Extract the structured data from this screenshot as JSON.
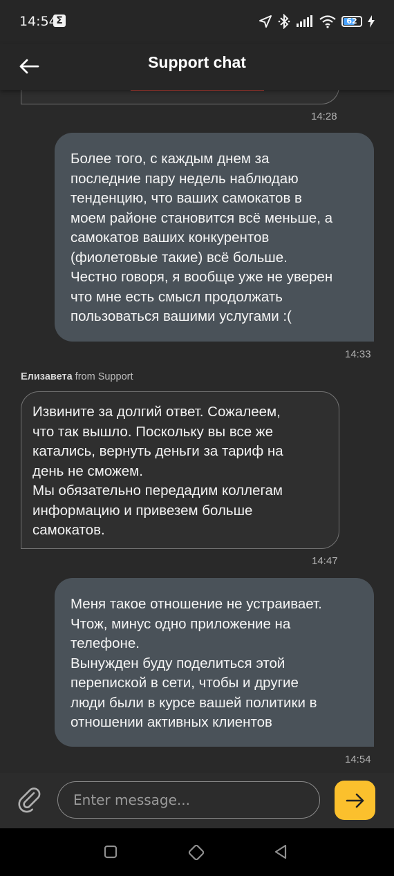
{
  "status_bar": {
    "time": "14:54",
    "notification_icon": "sigma-icon",
    "battery_level": "62",
    "icons": [
      "location-icon",
      "bluetooth-icon",
      "signal-icon",
      "wifi-icon",
      "battery-icon",
      "charging-icon"
    ]
  },
  "header": {
    "title": "Support chat",
    "back_icon": "arrow-left-icon"
  },
  "messages": [
    {
      "direction": "incoming",
      "partial": true,
      "time": "14:28"
    },
    {
      "direction": "outgoing",
      "text": "Более того, с каждым днем за\nпоследние пару недель наблюдаю\nтенденцию, что ваших самокатов в\nмоем районе становится всё меньше, а\nсамокатов ваших конкурентов\n(фиолетовые такие) всё больше.\nЧестно говоря, я вообще уже не уверен\nчто мне есть смысл продолжать\nпользоваться вашими услугами :(",
      "time": "14:33"
    },
    {
      "direction": "incoming",
      "sender_name": "Елизавета",
      "sender_suffix": "from Support",
      "text": "Извините за долгий ответ. Сожалеем,\nчто так вышло. Поскольку вы все же\nкатались, вернуть деньги за тариф на\nдень не сможем.\nМы обязательно передадим коллегам\nинформацию и привезем больше\nсамокатов.",
      "time": "14:47"
    },
    {
      "direction": "outgoing",
      "text": "Меня такое отношение не устраивает.\nЧтож, минус одно приложение на\nтелефоне.\nВынужден буду поделиться этой\nперепиской в сети, чтобы и другие\nлюди были в курсе вашей политики в\nотношении активных клиентов",
      "time": "14:54"
    }
  ],
  "composer": {
    "placeholder": "Enter message...",
    "value": "",
    "attach_icon": "paperclip-icon",
    "send_icon": "arrow-right-icon",
    "send_color": "#fbc02d"
  },
  "nav_bar": {
    "buttons": [
      "recents-square-icon",
      "home-diamond-icon",
      "back-triangle-icon"
    ]
  },
  "colors": {
    "background": "#292929",
    "outgoing_bubble": "#4a5259",
    "incoming_bubble_border": "#747474",
    "accent": "#fbc02d",
    "link_underline": "#d8453a"
  }
}
